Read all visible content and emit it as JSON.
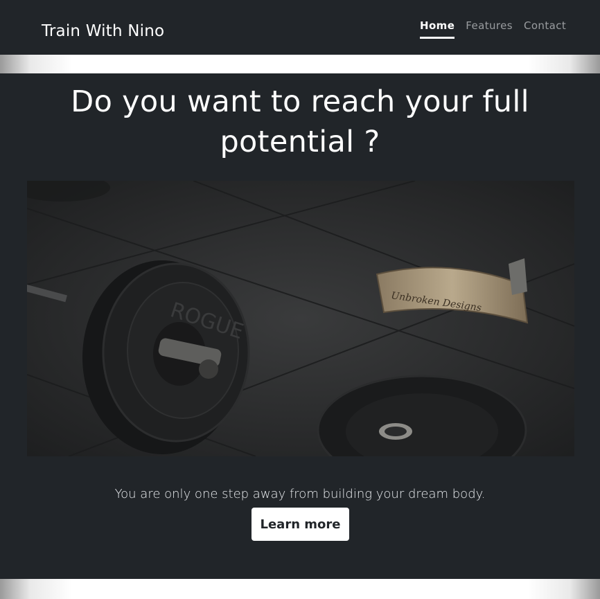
{
  "navbar": {
    "brand": "Train With Nino",
    "links": [
      {
        "label": "Home",
        "active": true
      },
      {
        "label": "Features",
        "active": false
      },
      {
        "label": "Contact",
        "active": false
      }
    ]
  },
  "hero": {
    "headline": "Do you want to reach your full potential ?",
    "image_text": "Unbroken Designs",
    "image_plate_text": "ROGUE",
    "tagline": "You are only one step away from building your dream body.",
    "cta_label": "Learn more"
  },
  "colors": {
    "background": "#212529",
    "text": "#ffffff",
    "nav_inactive": "#9a9da0",
    "button_bg": "#ffffff",
    "button_text": "#212529"
  }
}
